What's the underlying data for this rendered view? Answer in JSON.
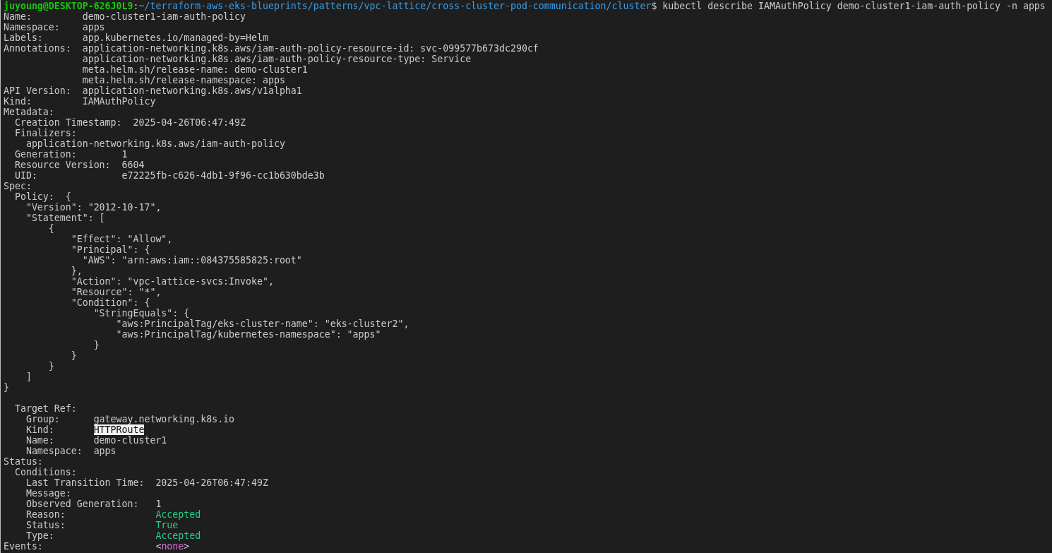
{
  "terminal": {
    "lines": [
      {
        "kind": "text",
        "segments": [
          {
            "kind": "user",
            "text": "juyoung@DESKTOP-626J0L9"
          },
          {
            "kind": "text",
            "text": ":"
          },
          {
            "kind": "path",
            "text": "~/terraform-aws-eks-blueprints/patterns/vpc-lattice/cross-cluster-pod-communication/cluster"
          },
          {
            "kind": "text",
            "text": "$ kubectl describe IAMAuthPolicy demo-cluster1-iam-auth-policy -n apps"
          }
        ]
      },
      {
        "kind": "text",
        "segments": [
          {
            "kind": "text",
            "text": "Name:         demo-cluster1-iam-auth-policy"
          }
        ]
      },
      {
        "kind": "text",
        "segments": [
          {
            "kind": "text",
            "text": "Namespace:    apps"
          }
        ]
      },
      {
        "kind": "text",
        "segments": [
          {
            "kind": "text",
            "text": "Labels:       app.kubernetes.io/managed-by=Helm"
          }
        ]
      },
      {
        "kind": "text",
        "segments": [
          {
            "kind": "text",
            "text": "Annotations:  application-networking.k8s.aws/iam-auth-policy-resource-id: svc-099577b673dc290cf"
          }
        ]
      },
      {
        "kind": "text",
        "segments": [
          {
            "kind": "text",
            "text": "              application-networking.k8s.aws/iam-auth-policy-resource-type: Service"
          }
        ]
      },
      {
        "kind": "text",
        "segments": [
          {
            "kind": "text",
            "text": "              meta.helm.sh/release-name: demo-cluster1"
          }
        ]
      },
      {
        "kind": "text",
        "segments": [
          {
            "kind": "text",
            "text": "              meta.helm.sh/release-namespace: apps"
          }
        ]
      },
      {
        "kind": "text",
        "segments": [
          {
            "kind": "text",
            "text": "API Version:  application-networking.k8s.aws/v1alpha1"
          }
        ]
      },
      {
        "kind": "text",
        "segments": [
          {
            "kind": "text",
            "text": "Kind:         IAMAuthPolicy"
          }
        ]
      },
      {
        "kind": "text",
        "segments": [
          {
            "kind": "text",
            "text": "Metadata:"
          }
        ]
      },
      {
        "kind": "text",
        "segments": [
          {
            "kind": "text",
            "text": "  Creation Timestamp:  2025-04-26T06:47:49Z"
          }
        ]
      },
      {
        "kind": "text",
        "segments": [
          {
            "kind": "text",
            "text": "  Finalizers:"
          }
        ]
      },
      {
        "kind": "text",
        "segments": [
          {
            "kind": "text",
            "text": "    application-networking.k8s.aws/iam-auth-policy"
          }
        ]
      },
      {
        "kind": "text",
        "segments": [
          {
            "kind": "text",
            "text": "  Generation:        1"
          }
        ]
      },
      {
        "kind": "text",
        "segments": [
          {
            "kind": "text",
            "text": "  Resource Version:  6604"
          }
        ]
      },
      {
        "kind": "text",
        "segments": [
          {
            "kind": "text",
            "text": "  UID:               e72225fb-c626-4db1-9f96-cc1b630bde3b"
          }
        ]
      },
      {
        "kind": "text",
        "segments": [
          {
            "kind": "text",
            "text": "Spec:"
          }
        ]
      },
      {
        "kind": "text",
        "segments": [
          {
            "kind": "text",
            "text": "  Policy:  {"
          }
        ]
      },
      {
        "kind": "text",
        "segments": [
          {
            "kind": "text",
            "text": "    \"Version\": \"2012-10-17\","
          }
        ]
      },
      {
        "kind": "text",
        "segments": [
          {
            "kind": "text",
            "text": "    \"Statement\": ["
          }
        ]
      },
      {
        "kind": "text",
        "segments": [
          {
            "kind": "text",
            "text": "        {"
          }
        ]
      },
      {
        "kind": "text",
        "segments": [
          {
            "kind": "text",
            "text": "            \"Effect\": \"Allow\","
          }
        ]
      },
      {
        "kind": "text",
        "segments": [
          {
            "kind": "text",
            "text": "            \"Principal\": {"
          }
        ]
      },
      {
        "kind": "text",
        "segments": [
          {
            "kind": "text",
            "text": "              \"AWS\": \"arn:aws:iam::084375585825:root\""
          }
        ]
      },
      {
        "kind": "text",
        "segments": [
          {
            "kind": "text",
            "text": "            },"
          }
        ]
      },
      {
        "kind": "text",
        "segments": [
          {
            "kind": "text",
            "text": "            \"Action\": \"vpc-lattice-svcs:Invoke\","
          }
        ]
      },
      {
        "kind": "text",
        "segments": [
          {
            "kind": "text",
            "text": "            \"Resource\": \"*\","
          }
        ]
      },
      {
        "kind": "text",
        "segments": [
          {
            "kind": "text",
            "text": "            \"Condition\": {"
          }
        ]
      },
      {
        "kind": "text",
        "segments": [
          {
            "kind": "text",
            "text": "                \"StringEquals\": {"
          }
        ]
      },
      {
        "kind": "text",
        "segments": [
          {
            "kind": "text",
            "text": "                    \"aws:PrincipalTag/eks-cluster-name\": \"eks-cluster2\","
          }
        ]
      },
      {
        "kind": "text",
        "segments": [
          {
            "kind": "text",
            "text": "                    \"aws:PrincipalTag/kubernetes-namespace\": \"apps\""
          }
        ]
      },
      {
        "kind": "text",
        "segments": [
          {
            "kind": "text",
            "text": "                }"
          }
        ]
      },
      {
        "kind": "text",
        "segments": [
          {
            "kind": "text",
            "text": "            }"
          }
        ]
      },
      {
        "kind": "text",
        "segments": [
          {
            "kind": "text",
            "text": "        }"
          }
        ]
      },
      {
        "kind": "text",
        "segments": [
          {
            "kind": "text",
            "text": "    ]"
          }
        ]
      },
      {
        "kind": "text",
        "segments": [
          {
            "kind": "text",
            "text": "}"
          }
        ]
      },
      {
        "kind": "blank"
      },
      {
        "kind": "text",
        "segments": [
          {
            "kind": "text",
            "text": "  Target Ref:"
          }
        ]
      },
      {
        "kind": "text",
        "segments": [
          {
            "kind": "text",
            "text": "    Group:      gateway.networking.k8s.io"
          }
        ]
      },
      {
        "kind": "text",
        "segments": [
          {
            "kind": "text",
            "text": "    Kind:       "
          },
          {
            "kind": "highlight",
            "text": "HTTPRoute"
          }
        ]
      },
      {
        "kind": "text",
        "segments": [
          {
            "kind": "text",
            "text": "    Name:       demo-cluster1"
          }
        ]
      },
      {
        "kind": "text",
        "segments": [
          {
            "kind": "text",
            "text": "    Namespace:  apps"
          }
        ]
      },
      {
        "kind": "text",
        "segments": [
          {
            "kind": "text",
            "text": "Status:"
          }
        ]
      },
      {
        "kind": "text",
        "segments": [
          {
            "kind": "text",
            "text": "  Conditions:"
          }
        ]
      },
      {
        "kind": "text",
        "segments": [
          {
            "kind": "text",
            "text": "    Last Transition Time:  2025-04-26T06:47:49Z"
          }
        ]
      },
      {
        "kind": "text",
        "segments": [
          {
            "kind": "text",
            "text": "    Message:"
          }
        ]
      },
      {
        "kind": "text",
        "segments": [
          {
            "kind": "text",
            "text": "    Observed Generation:   1"
          }
        ]
      },
      {
        "kind": "text",
        "segments": [
          {
            "kind": "text",
            "text": "    Reason:                "
          },
          {
            "kind": "ok",
            "text": "Accepted"
          }
        ]
      },
      {
        "kind": "text",
        "segments": [
          {
            "kind": "text",
            "text": "    Status:                "
          },
          {
            "kind": "ok",
            "text": "True"
          }
        ]
      },
      {
        "kind": "text",
        "segments": [
          {
            "kind": "text",
            "text": "    Type:                  "
          },
          {
            "kind": "ok",
            "text": "Accepted"
          }
        ]
      },
      {
        "kind": "text",
        "segments": [
          {
            "kind": "text",
            "text": "Events:                    <"
          },
          {
            "kind": "keyword",
            "text": "none"
          },
          {
            "kind": "text",
            "text": ">"
          }
        ]
      }
    ]
  }
}
